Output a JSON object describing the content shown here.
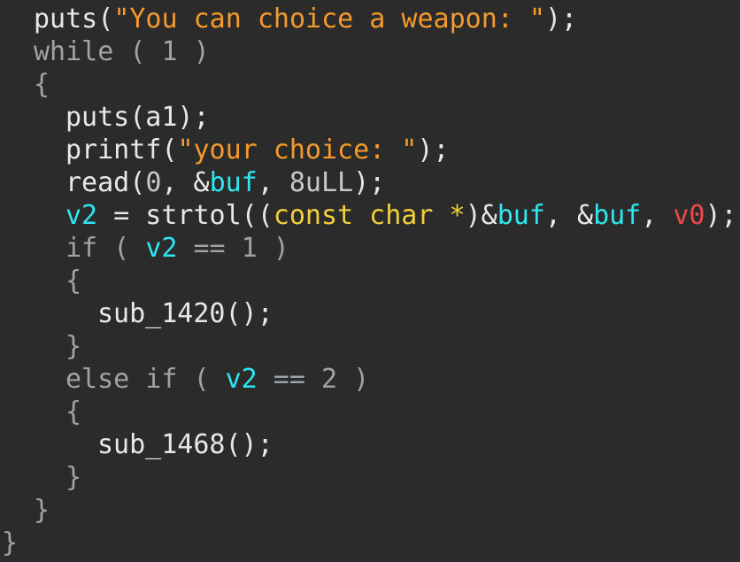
{
  "colors": {
    "background": "#2b2b2b",
    "default": "#e8e8e8",
    "keyword": "#9ea3a7",
    "string": "#f59a2b",
    "variable": "#2ee6f0",
    "type": "#f2d03a",
    "special": "#f04848",
    "number": "#c8c8c8"
  },
  "lines": [
    {
      "indent": 1,
      "tokens": [
        {
          "t": "puts(",
          "c": "default"
        },
        {
          "t": "\"You can choice a weapon: \"",
          "c": "string"
        },
        {
          "t": ");",
          "c": "default"
        }
      ]
    },
    {
      "indent": 1,
      "tokens": [
        {
          "t": "while ( 1 )",
          "c": "keyword"
        }
      ]
    },
    {
      "indent": 1,
      "tokens": [
        {
          "t": "{",
          "c": "keyword"
        }
      ]
    },
    {
      "indent": 2,
      "tokens": [
        {
          "t": "puts(a1);",
          "c": "default"
        }
      ]
    },
    {
      "indent": 2,
      "tokens": [
        {
          "t": "printf(",
          "c": "default"
        },
        {
          "t": "\"your choice: \"",
          "c": "string"
        },
        {
          "t": ");",
          "c": "default"
        }
      ]
    },
    {
      "indent": 2,
      "tokens": [
        {
          "t": "read(",
          "c": "default"
        },
        {
          "t": "0",
          "c": "number"
        },
        {
          "t": ", &",
          "c": "default"
        },
        {
          "t": "buf",
          "c": "variable"
        },
        {
          "t": ", ",
          "c": "default"
        },
        {
          "t": "8uLL",
          "c": "number"
        },
        {
          "t": ");",
          "c": "default"
        }
      ]
    },
    {
      "indent": 2,
      "tokens": [
        {
          "t": "v2",
          "c": "variable"
        },
        {
          "t": " = strtol((",
          "c": "default"
        },
        {
          "t": "const char *",
          "c": "type"
        },
        {
          "t": ")&",
          "c": "default"
        },
        {
          "t": "buf",
          "c": "variable"
        },
        {
          "t": ", &",
          "c": "default"
        },
        {
          "t": "buf",
          "c": "variable"
        },
        {
          "t": ", ",
          "c": "default"
        },
        {
          "t": "v0",
          "c": "special"
        },
        {
          "t": ");",
          "c": "default"
        }
      ]
    },
    {
      "indent": 2,
      "tokens": [
        {
          "t": "if ( ",
          "c": "keyword"
        },
        {
          "t": "v2",
          "c": "variable"
        },
        {
          "t": " == 1 )",
          "c": "keyword"
        }
      ]
    },
    {
      "indent": 2,
      "tokens": [
        {
          "t": "{",
          "c": "keyword"
        }
      ]
    },
    {
      "indent": 3,
      "tokens": [
        {
          "t": "sub_1420();",
          "c": "default"
        }
      ]
    },
    {
      "indent": 2,
      "tokens": [
        {
          "t": "}",
          "c": "keyword"
        }
      ]
    },
    {
      "indent": 2,
      "tokens": [
        {
          "t": "else if ( ",
          "c": "keyword"
        },
        {
          "t": "v2",
          "c": "variable"
        },
        {
          "t": " == 2 )",
          "c": "keyword"
        }
      ]
    },
    {
      "indent": 2,
      "tokens": [
        {
          "t": "{",
          "c": "keyword"
        }
      ]
    },
    {
      "indent": 3,
      "tokens": [
        {
          "t": "sub_1468();",
          "c": "default"
        }
      ]
    },
    {
      "indent": 2,
      "tokens": [
        {
          "t": "}",
          "c": "keyword"
        }
      ]
    },
    {
      "indent": 1,
      "tokens": [
        {
          "t": "}",
          "c": "keyword"
        }
      ]
    },
    {
      "indent": 0,
      "tokens": [
        {
          "t": "}",
          "c": "keyword"
        }
      ]
    }
  ]
}
